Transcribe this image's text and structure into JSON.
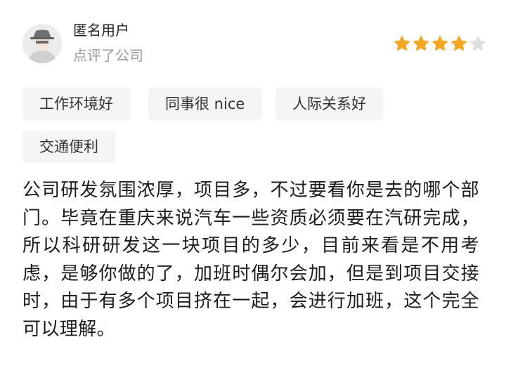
{
  "user": {
    "name": "匿名用户",
    "action": "点评了公司",
    "avatar_icon": "anonymous-user-icon"
  },
  "rating": {
    "score": 4,
    "max": 5,
    "filled_color": "#f5a623",
    "empty_color": "#dedede"
  },
  "tags": [
    "工作环境好",
    "同事很 nice",
    "人际关系好",
    "交通便利"
  ],
  "review": {
    "text": "公司研发氛围浓厚，项目多，不过要看你是去的哪个部门。毕竟在重庆来说汽车一些资质必须要在汽研完成，所以科研研发这一块项目的多少，目前来看是不用考虑，是够你做的了，加班时偶尔会加，但是到项目交接时，由于有多个项目挤在一起，会进行加班，这个完全可以理解。"
  }
}
